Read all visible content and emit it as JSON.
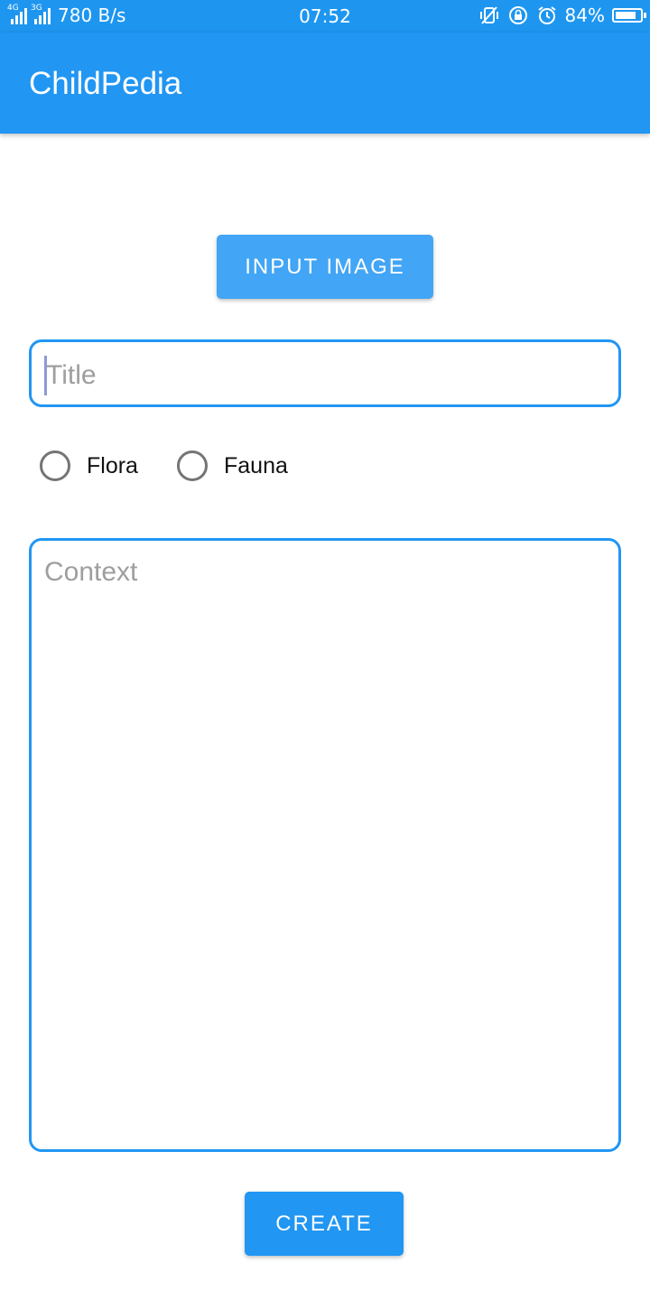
{
  "status_bar": {
    "network_1": "4G",
    "network_2": "3G",
    "net_speed": "780 B/s",
    "time": "07:52",
    "battery": "84%",
    "battery_level": 0.84,
    "icons": [
      "vibrate-icon",
      "rotation-lock-icon",
      "alarm-icon",
      "battery-icon"
    ]
  },
  "app_bar": {
    "title": "ChildPedia",
    "color": "#2196f3"
  },
  "form": {
    "input_image_label": "INPUT IMAGE",
    "title": {
      "value": "",
      "placeholder": "Title"
    },
    "category_options": [
      {
        "label": "Flora",
        "selected": false
      },
      {
        "label": "Fauna",
        "selected": false
      }
    ],
    "context": {
      "value": "",
      "placeholder": "Context"
    },
    "create_label": "CREATE"
  },
  "colors": {
    "status_bar": "#1e96f0",
    "accent": "#2196f3",
    "input_image_button": "#42a5f5",
    "placeholder": "#9e9e9e"
  }
}
